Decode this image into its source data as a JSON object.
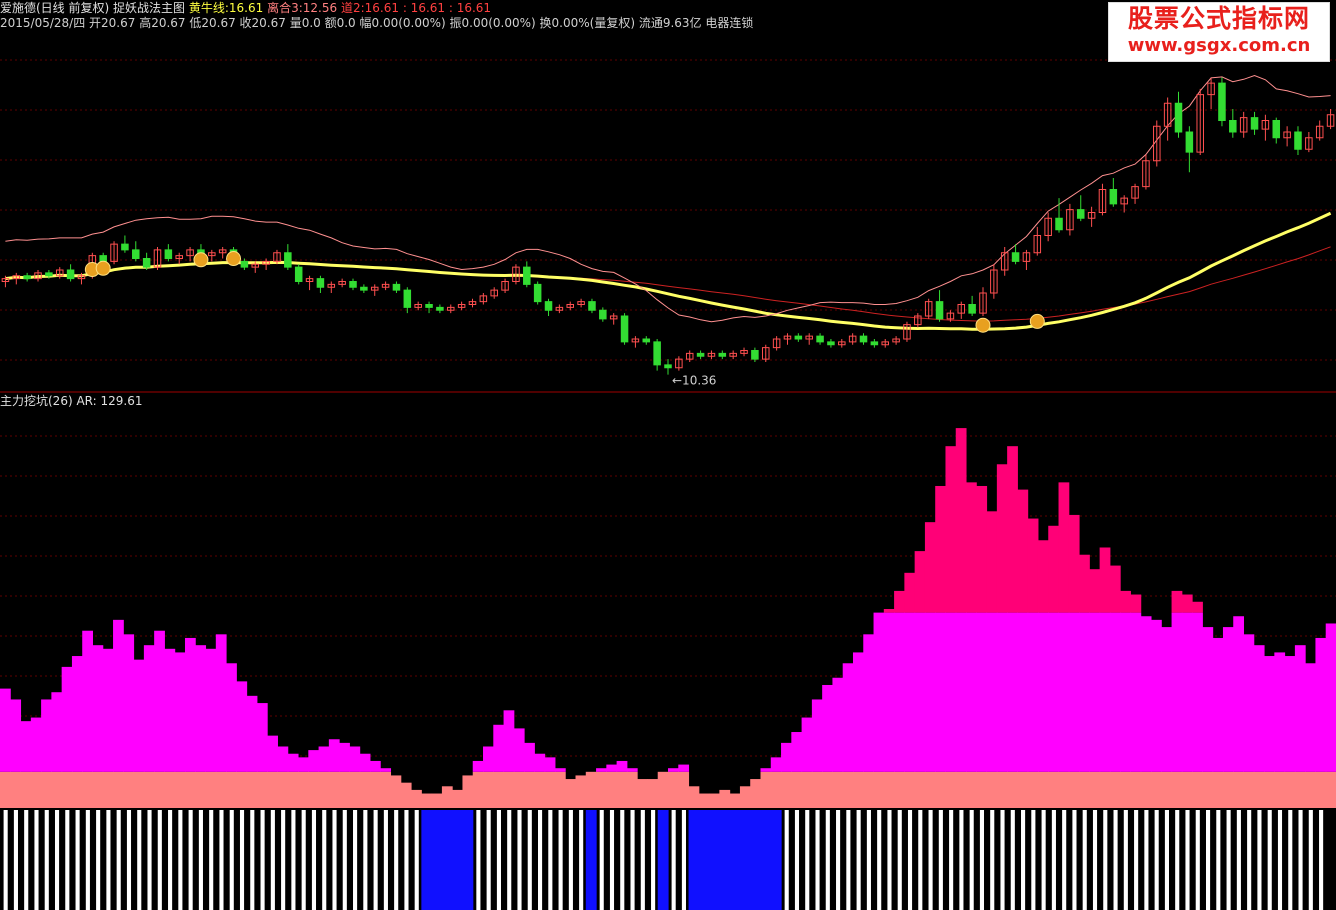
{
  "header": {
    "stock_name": "爱施德(日线 前复权)",
    "indicator_name": "捉妖战法主图",
    "yellow_line_label": "黄牛线:",
    "yellow_line_value": "16.61",
    "convergence_label": "离合3:",
    "convergence_value": "12.56",
    "road2_label": "道2:",
    "road2_values": "16.61  : 16.61  : 16.61",
    "info_line": "2015/05/28/四 开20.67 高20.67 低20.67 收20.67 量0.0 额0.0 幅0.00(0.00%) 振0.00(0.00%) 换0.00%(量复权) 流通9.63亿 电器连锁",
    "sub_title": "主力挖坑(26)",
    "sub_value": "AR: 129.61",
    "low_marker": "←10.36"
  },
  "watermark": {
    "title": "股票公式指标网",
    "url": "www.gsgx.com.cn"
  },
  "colors": {
    "background": "#000000",
    "up_candle": "#ff5050",
    "down_candle": "#33dd33",
    "yellow_line": "#ffff66",
    "red_line": "#cc2222",
    "pink_line": "#ff9090",
    "ar_magenta": "#ff00ff",
    "ar_deep": "#ff0077",
    "ar_salmon": "#ff8080",
    "pit_blue": "#1010ff",
    "grid": "#600000"
  },
  "chart_data": [
    {
      "type": "line",
      "panel": "main",
      "description_hidden": true,
      "ylim": [
        10.0,
        22.0
      ],
      "low_value": 10.36,
      "candles": [
        [
          13.6,
          13.8,
          13.4,
          13.7
        ],
        [
          13.7,
          13.9,
          13.5,
          13.8
        ],
        [
          13.8,
          13.9,
          13.6,
          13.7
        ],
        [
          13.7,
          14.0,
          13.6,
          13.9
        ],
        [
          13.9,
          14.0,
          13.7,
          13.8
        ],
        [
          13.8,
          14.1,
          13.7,
          14.0
        ],
        [
          14.0,
          14.2,
          13.6,
          13.7
        ],
        [
          13.7,
          13.9,
          13.5,
          13.8
        ],
        [
          13.8,
          14.6,
          13.7,
          14.5
        ],
        [
          14.5,
          14.6,
          14.2,
          14.3
        ],
        [
          14.3,
          15.0,
          14.2,
          14.9
        ],
        [
          14.9,
          15.2,
          14.6,
          14.7
        ],
        [
          14.7,
          15.0,
          14.3,
          14.4
        ],
        [
          14.4,
          14.6,
          14.0,
          14.1
        ],
        [
          14.1,
          14.8,
          14.0,
          14.7
        ],
        [
          14.7,
          14.9,
          14.3,
          14.4
        ],
        [
          14.4,
          14.6,
          14.2,
          14.5
        ],
        [
          14.5,
          14.8,
          14.3,
          14.7
        ],
        [
          14.7,
          14.9,
          14.4,
          14.5
        ],
        [
          14.5,
          14.7,
          14.3,
          14.6
        ],
        [
          14.6,
          14.8,
          14.4,
          14.7
        ],
        [
          14.7,
          14.8,
          14.2,
          14.3
        ],
        [
          14.3,
          14.4,
          14.0,
          14.1
        ],
        [
          14.1,
          14.3,
          13.9,
          14.2
        ],
        [
          14.2,
          14.4,
          14.0,
          14.3
        ],
        [
          14.3,
          14.7,
          14.2,
          14.6
        ],
        [
          14.6,
          14.9,
          14.0,
          14.1
        ],
        [
          14.1,
          14.2,
          13.5,
          13.6
        ],
        [
          13.6,
          13.8,
          13.3,
          13.7
        ],
        [
          13.7,
          13.8,
          13.2,
          13.4
        ],
        [
          13.4,
          13.6,
          13.2,
          13.5
        ],
        [
          13.5,
          13.7,
          13.4,
          13.6
        ],
        [
          13.6,
          13.7,
          13.3,
          13.4
        ],
        [
          13.4,
          13.5,
          13.2,
          13.3
        ],
        [
          13.3,
          13.5,
          13.1,
          13.4
        ],
        [
          13.4,
          13.6,
          13.3,
          13.5
        ],
        [
          13.5,
          13.6,
          13.2,
          13.3
        ],
        [
          13.3,
          13.4,
          12.5,
          12.7
        ],
        [
          12.7,
          12.9,
          12.6,
          12.8
        ],
        [
          12.8,
          12.9,
          12.5,
          12.7
        ],
        [
          12.7,
          12.8,
          12.5,
          12.6
        ],
        [
          12.6,
          12.8,
          12.5,
          12.7
        ],
        [
          12.7,
          12.9,
          12.6,
          12.8
        ],
        [
          12.8,
          13.0,
          12.7,
          12.9
        ],
        [
          12.9,
          13.2,
          12.8,
          13.1
        ],
        [
          13.1,
          13.4,
          13.0,
          13.3
        ],
        [
          13.3,
          13.7,
          13.2,
          13.6
        ],
        [
          13.6,
          14.2,
          13.5,
          14.1
        ],
        [
          14.1,
          14.3,
          13.4,
          13.5
        ],
        [
          13.5,
          13.6,
          12.8,
          12.9
        ],
        [
          12.9,
          13.0,
          12.4,
          12.6
        ],
        [
          12.6,
          12.8,
          12.5,
          12.7
        ],
        [
          12.7,
          12.9,
          12.6,
          12.8
        ],
        [
          12.8,
          13.0,
          12.7,
          12.9
        ],
        [
          12.9,
          13.0,
          12.5,
          12.6
        ],
        [
          12.6,
          12.7,
          12.2,
          12.3
        ],
        [
          12.3,
          12.5,
          12.1,
          12.4
        ],
        [
          12.4,
          12.5,
          11.4,
          11.5
        ],
        [
          11.5,
          11.7,
          11.3,
          11.6
        ],
        [
          11.6,
          11.7,
          11.4,
          11.5
        ],
        [
          11.5,
          11.6,
          10.5,
          10.7
        ],
        [
          10.7,
          10.9,
          10.36,
          10.6
        ],
        [
          10.6,
          11.0,
          10.5,
          10.9
        ],
        [
          10.9,
          11.2,
          10.8,
          11.1
        ],
        [
          11.1,
          11.2,
          10.9,
          11.0
        ],
        [
          11.0,
          11.2,
          10.9,
          11.1
        ],
        [
          11.1,
          11.2,
          10.9,
          11.0
        ],
        [
          11.0,
          11.2,
          10.9,
          11.1
        ],
        [
          11.1,
          11.3,
          11.0,
          11.2
        ],
        [
          11.2,
          11.3,
          10.8,
          10.9
        ],
        [
          10.9,
          11.4,
          10.8,
          11.3
        ],
        [
          11.3,
          11.7,
          11.2,
          11.6
        ],
        [
          11.6,
          11.8,
          11.4,
          11.7
        ],
        [
          11.7,
          11.8,
          11.5,
          11.6
        ],
        [
          11.6,
          11.8,
          11.4,
          11.7
        ],
        [
          11.7,
          11.8,
          11.4,
          11.5
        ],
        [
          11.5,
          11.6,
          11.3,
          11.4
        ],
        [
          11.4,
          11.6,
          11.3,
          11.5
        ],
        [
          11.5,
          11.8,
          11.4,
          11.7
        ],
        [
          11.7,
          11.8,
          11.4,
          11.5
        ],
        [
          11.5,
          11.6,
          11.3,
          11.4
        ],
        [
          11.4,
          11.6,
          11.3,
          11.5
        ],
        [
          11.5,
          11.7,
          11.4,
          11.6
        ],
        [
          11.6,
          12.2,
          11.5,
          12.1
        ],
        [
          12.1,
          12.5,
          12.0,
          12.4
        ],
        [
          12.4,
          13.0,
          12.3,
          12.9
        ],
        [
          12.9,
          13.3,
          12.2,
          12.3
        ],
        [
          12.3,
          12.6,
          12.2,
          12.5
        ],
        [
          12.5,
          12.9,
          12.3,
          12.8
        ],
        [
          12.8,
          13.1,
          12.4,
          12.5
        ],
        [
          12.5,
          13.4,
          12.4,
          13.2
        ],
        [
          13.2,
          14.2,
          13.0,
          14.0
        ],
        [
          14.0,
          14.8,
          13.8,
          14.6
        ],
        [
          14.6,
          14.9,
          14.2,
          14.3
        ],
        [
          14.3,
          14.7,
          14.0,
          14.6
        ],
        [
          14.6,
          15.5,
          14.5,
          15.2
        ],
        [
          15.2,
          16.0,
          15.0,
          15.8
        ],
        [
          15.8,
          16.5,
          15.3,
          15.4
        ],
        [
          15.4,
          16.3,
          15.2,
          16.1
        ],
        [
          16.1,
          16.6,
          15.7,
          15.8
        ],
        [
          15.8,
          16.2,
          15.5,
          16.0
        ],
        [
          16.0,
          17.0,
          15.9,
          16.8
        ],
        [
          16.8,
          17.2,
          16.2,
          16.3
        ],
        [
          16.3,
          16.6,
          16.0,
          16.5
        ],
        [
          16.5,
          17.0,
          16.3,
          16.9
        ],
        [
          16.9,
          18.0,
          16.8,
          17.8
        ],
        [
          17.8,
          19.2,
          17.6,
          19.0
        ],
        [
          19.0,
          20.0,
          18.5,
          19.8
        ],
        [
          19.8,
          20.2,
          18.6,
          18.8
        ],
        [
          18.8,
          19.0,
          17.4,
          18.1
        ],
        [
          18.1,
          20.3,
          18.0,
          20.1
        ],
        [
          20.1,
          20.67,
          19.6,
          20.5
        ],
        [
          20.5,
          20.7,
          19.0,
          19.2
        ],
        [
          19.2,
          19.6,
          18.6,
          18.8
        ],
        [
          18.8,
          19.5,
          18.6,
          19.3
        ],
        [
          19.3,
          19.5,
          18.7,
          18.9
        ],
        [
          18.9,
          19.4,
          18.5,
          19.2
        ],
        [
          19.2,
          19.3,
          18.4,
          18.6
        ],
        [
          18.6,
          19.0,
          18.3,
          18.8
        ],
        [
          18.8,
          19.0,
          18.0,
          18.2
        ],
        [
          18.2,
          18.8,
          18.1,
          18.6
        ],
        [
          18.6,
          19.2,
          18.5,
          19.0
        ],
        [
          19.0,
          19.6,
          18.9,
          19.4
        ]
      ]
    },
    {
      "type": "bar",
      "panel": "sub",
      "ylim": [
        0,
        220
      ],
      "series": [
        {
          "values": [
            66,
            60,
            48,
            50,
            60,
            64,
            78,
            84,
            98,
            90,
            88,
            104,
            96,
            82,
            90,
            98,
            88,
            86,
            94,
            90,
            88,
            96,
            80,
            70,
            62,
            58,
            40,
            34,
            30,
            28,
            32,
            34,
            38,
            36,
            34,
            30,
            26,
            22,
            18,
            14,
            10,
            8,
            8,
            12,
            10,
            18,
            26,
            34,
            46,
            54,
            44,
            36,
            30,
            28,
            22,
            16,
            18,
            20,
            22,
            24,
            26,
            22,
            16,
            16,
            20,
            22,
            24,
            12,
            8,
            8,
            10,
            8,
            12,
            16,
            22,
            28,
            36,
            42,
            50,
            60,
            68,
            72,
            80,
            86,
            96,
            108,
            110,
            120,
            130,
            142,
            158,
            178,
            200,
            210,
            180,
            178,
            164,
            190,
            200,
            176,
            160,
            148,
            156,
            180,
            162,
            140,
            132,
            144,
            134,
            120,
            118,
            106,
            104,
            100,
            120,
            118,
            114,
            100,
            94,
            100,
            106,
            96,
            90,
            84,
            86,
            84,
            90,
            80,
            94,
            102
          ]
        }
      ],
      "pit_markers": [
        0,
        0,
        0,
        0,
        0,
        0,
        0,
        0,
        0,
        0,
        0,
        0,
        0,
        0,
        0,
        0,
        0,
        0,
        0,
        0,
        0,
        0,
        0,
        0,
        0,
        0,
        0,
        0,
        0,
        0,
        0,
        0,
        0,
        0,
        0,
        0,
        0,
        0,
        0,
        0,
        0,
        1,
        1,
        1,
        1,
        1,
        0,
        0,
        0,
        0,
        0,
        0,
        0,
        0,
        0,
        0,
        0,
        1,
        0,
        0,
        0,
        0,
        0,
        0,
        1,
        0,
        0,
        1,
        1,
        1,
        1,
        1,
        1,
        1,
        1,
        1,
        0,
        0,
        0,
        0,
        0,
        0,
        0,
        0,
        0,
        0,
        0,
        0,
        0,
        0,
        0,
        0,
        0,
        0,
        0,
        0,
        0,
        0,
        0,
        0,
        0,
        0,
        0,
        0,
        0,
        0,
        0,
        0,
        0,
        0,
        0,
        0,
        0,
        0,
        0,
        0,
        0,
        0,
        0,
        0,
        0,
        0,
        0,
        0,
        0,
        0,
        0,
        0,
        0
      ]
    }
  ]
}
